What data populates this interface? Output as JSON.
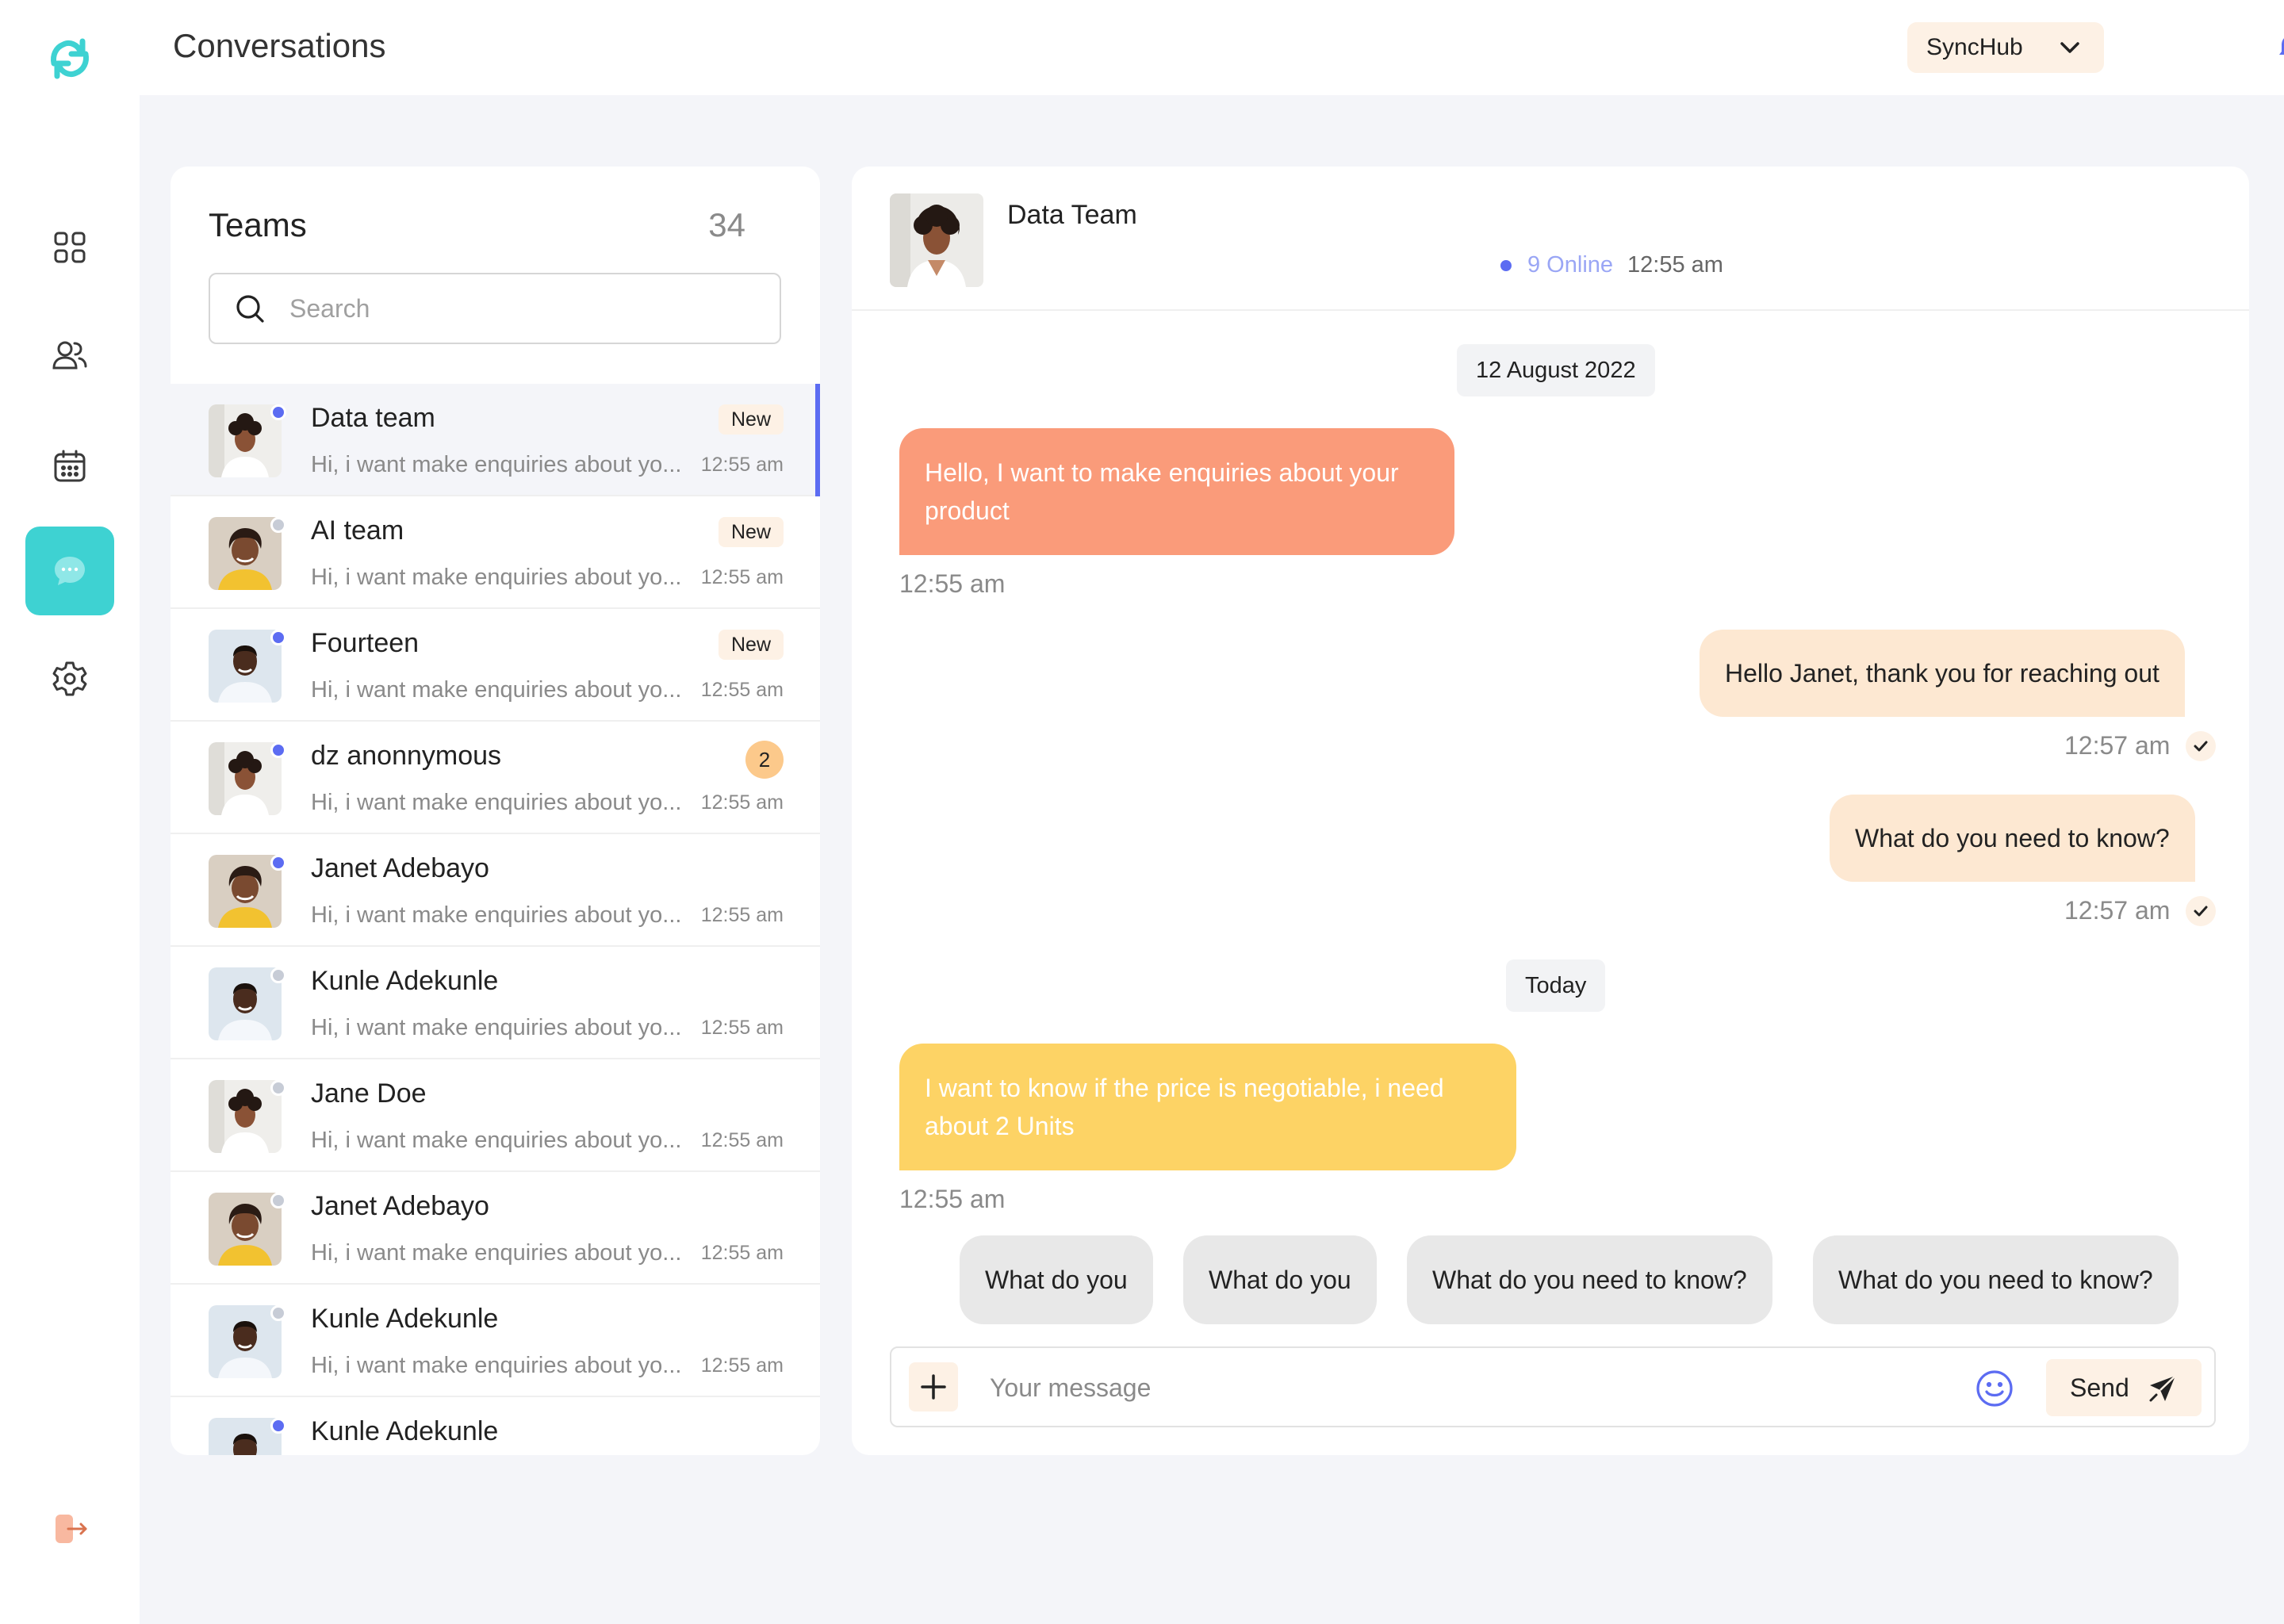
{
  "app": {
    "title": "Conversations",
    "workspace": "SyncHub"
  },
  "nav": {
    "items": [
      {
        "icon": "grid-icon"
      },
      {
        "icon": "users-icon"
      },
      {
        "icon": "calendar-icon"
      },
      {
        "icon": "chat-icon",
        "active": true
      },
      {
        "icon": "gear-icon"
      }
    ],
    "logout_icon": "logout-icon"
  },
  "teams": {
    "title": "Teams",
    "count": "34",
    "search_placeholder": "Search",
    "items": [
      {
        "name": "Data team",
        "preview": "Hi, i want make enquiries about yo...",
        "time": "12:55 am",
        "badge": "New",
        "status": "online",
        "avatar": "woman-white-top"
      },
      {
        "name": "AI team",
        "preview": "Hi, i want make enquiries about yo...",
        "time": "12:55 am",
        "badge": "New",
        "status": "offline",
        "avatar": "woman-yellow-top"
      },
      {
        "name": "Fourteen",
        "preview": "Hi, i want make enquiries about yo...",
        "time": "12:55 am",
        "badge": "New",
        "status": "online",
        "avatar": "man-white-shirt"
      },
      {
        "name": "dz anonnymous",
        "preview": "Hi, i want make enquiries about yo...",
        "time": "12:55 am",
        "count": "2",
        "status": "online",
        "avatar": "woman-white-top"
      },
      {
        "name": "Janet Adebayo",
        "preview": "Hi, i want make enquiries about yo...",
        "time": "12:55 am",
        "status": "online",
        "avatar": "woman-yellow-top"
      },
      {
        "name": "Kunle Adekunle",
        "preview": "Hi, i want make enquiries about yo...",
        "time": "12:55 am",
        "status": "offline",
        "avatar": "man-white-shirt"
      },
      {
        "name": "Jane Doe",
        "preview": "Hi, i want make enquiries about yo...",
        "time": "12:55 am",
        "status": "offline",
        "avatar": "woman-white-top"
      },
      {
        "name": "Janet Adebayo",
        "preview": "Hi, i want make enquiries about yo...",
        "time": "12:55 am",
        "status": "offline",
        "avatar": "woman-yellow-top"
      },
      {
        "name": "Kunle Adekunle",
        "preview": "Hi, i want make enquiries about yo...",
        "time": "12:55 am",
        "status": "offline",
        "avatar": "man-white-shirt"
      },
      {
        "name": "Kunle Adekunle",
        "preview": "",
        "time": "",
        "status": "online",
        "avatar": "man-white-shirt"
      }
    ]
  },
  "chat": {
    "name": "Data Team",
    "online": "9 Online",
    "time": "12:55 am",
    "date_1": "12 August 2022",
    "date_2": "Today",
    "messages": [
      {
        "text": "Hello, I want to make enquiries about your product",
        "time": "12:55 am",
        "dir": "in"
      },
      {
        "text": "Hello Janet, thank you for reaching out",
        "time": "12:57 am",
        "dir": "out"
      },
      {
        "text": "What do you need to know?",
        "time": "12:57 am",
        "dir": "out"
      },
      {
        "text": "I want to know if the price is negotiable, i need about 2 Units",
        "time": "12:55 am",
        "dir": "in"
      }
    ],
    "quick_replies": [
      "What do you",
      "What do you",
      "What do you need to know?",
      "What do you need to know?"
    ],
    "input_placeholder": "Your message",
    "send_label": "Send"
  },
  "colors": {
    "accent": "#3ED2D2",
    "primary_blue": "#5C6CF2",
    "peach": "#FDF1E5",
    "incoming_1": "#FA9B7A",
    "incoming_2": "#FDD365",
    "outgoing": "#FDE8D2"
  }
}
